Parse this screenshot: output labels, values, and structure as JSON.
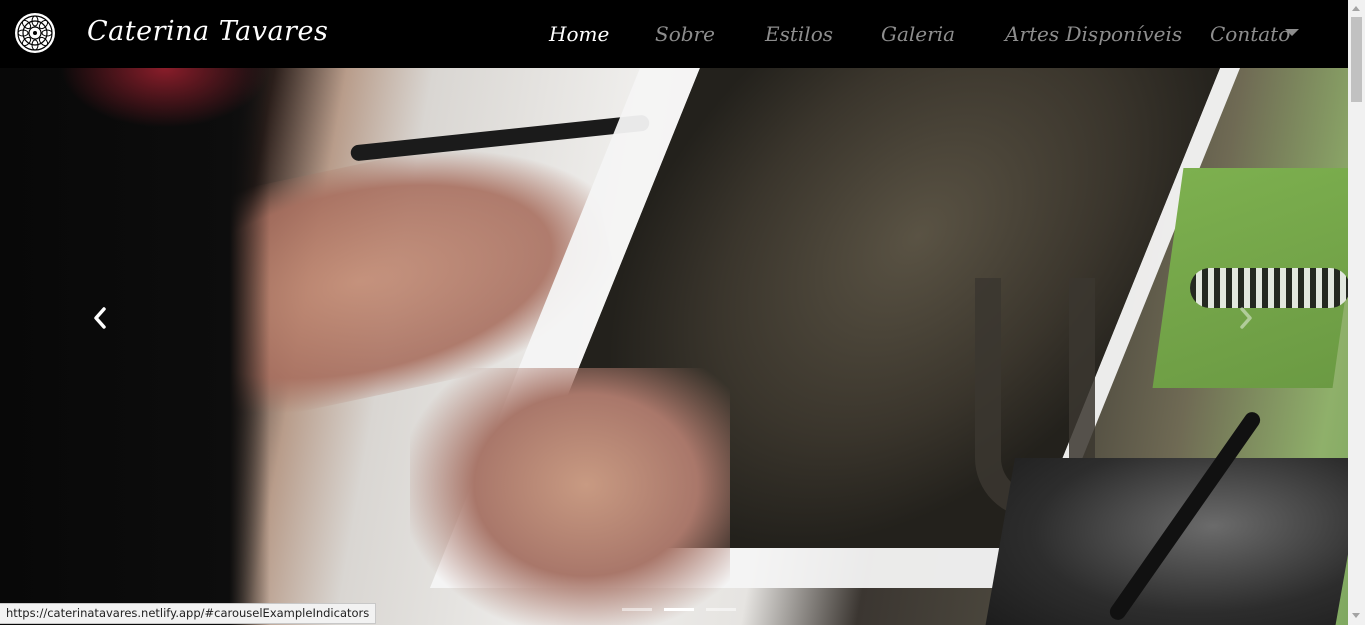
{
  "navbar": {
    "brand": "Caterina Tavares",
    "items": [
      {
        "label": "Home",
        "active": true
      },
      {
        "label": "Sobre",
        "active": false
      },
      {
        "label": "Estilos",
        "active": false
      },
      {
        "label": "Galeria",
        "active": false
      },
      {
        "label": "Artes Disponíveis",
        "active": false
      },
      {
        "label": "Contato",
        "active": false,
        "dropdown": true
      }
    ]
  },
  "carousel": {
    "slide_count": 3,
    "active_slide": 2,
    "prev_icon": "chevron-left-icon",
    "next_icon": "chevron-right-icon"
  },
  "status_bar": {
    "url": "https://caterinatavares.netlify.app/#carouselExampleIndicators"
  },
  "colors": {
    "navbar_bg": "#000000",
    "nav_active": "#ffffff",
    "nav_inactive": "#8d8d8d"
  }
}
